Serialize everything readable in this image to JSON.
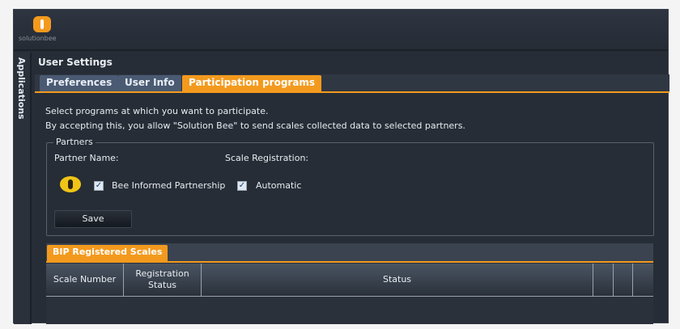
{
  "header": {
    "logo_text": "solutionbee"
  },
  "sidebar": {
    "label": "Applications"
  },
  "page": {
    "title": "User Settings"
  },
  "tabs": [
    {
      "label": "Preferences"
    },
    {
      "label": "User Info"
    },
    {
      "label": "Participation programs",
      "active": true
    }
  ],
  "intro": {
    "line1": "Select programs at which you want to participate.",
    "line2": "By accepting this, you allow \"Solution Bee\" to send scales collected data to selected partners."
  },
  "partners": {
    "legend": "Partners",
    "col_name": "Partner Name:",
    "col_reg": "Scale Registration:",
    "items": [
      {
        "name": "Bee Informed Partnership",
        "checked": true,
        "registration": "Automatic",
        "registration_checked": true
      }
    ],
    "save_label": "Save"
  },
  "bip": {
    "tab": "BIP Registered Scales",
    "columns": [
      "Scale Number",
      "Registration Status",
      "Status"
    ],
    "rows": []
  },
  "colors": {
    "accent": "#f39a1e",
    "background": "#262d36",
    "tab": "#4a5a72"
  }
}
